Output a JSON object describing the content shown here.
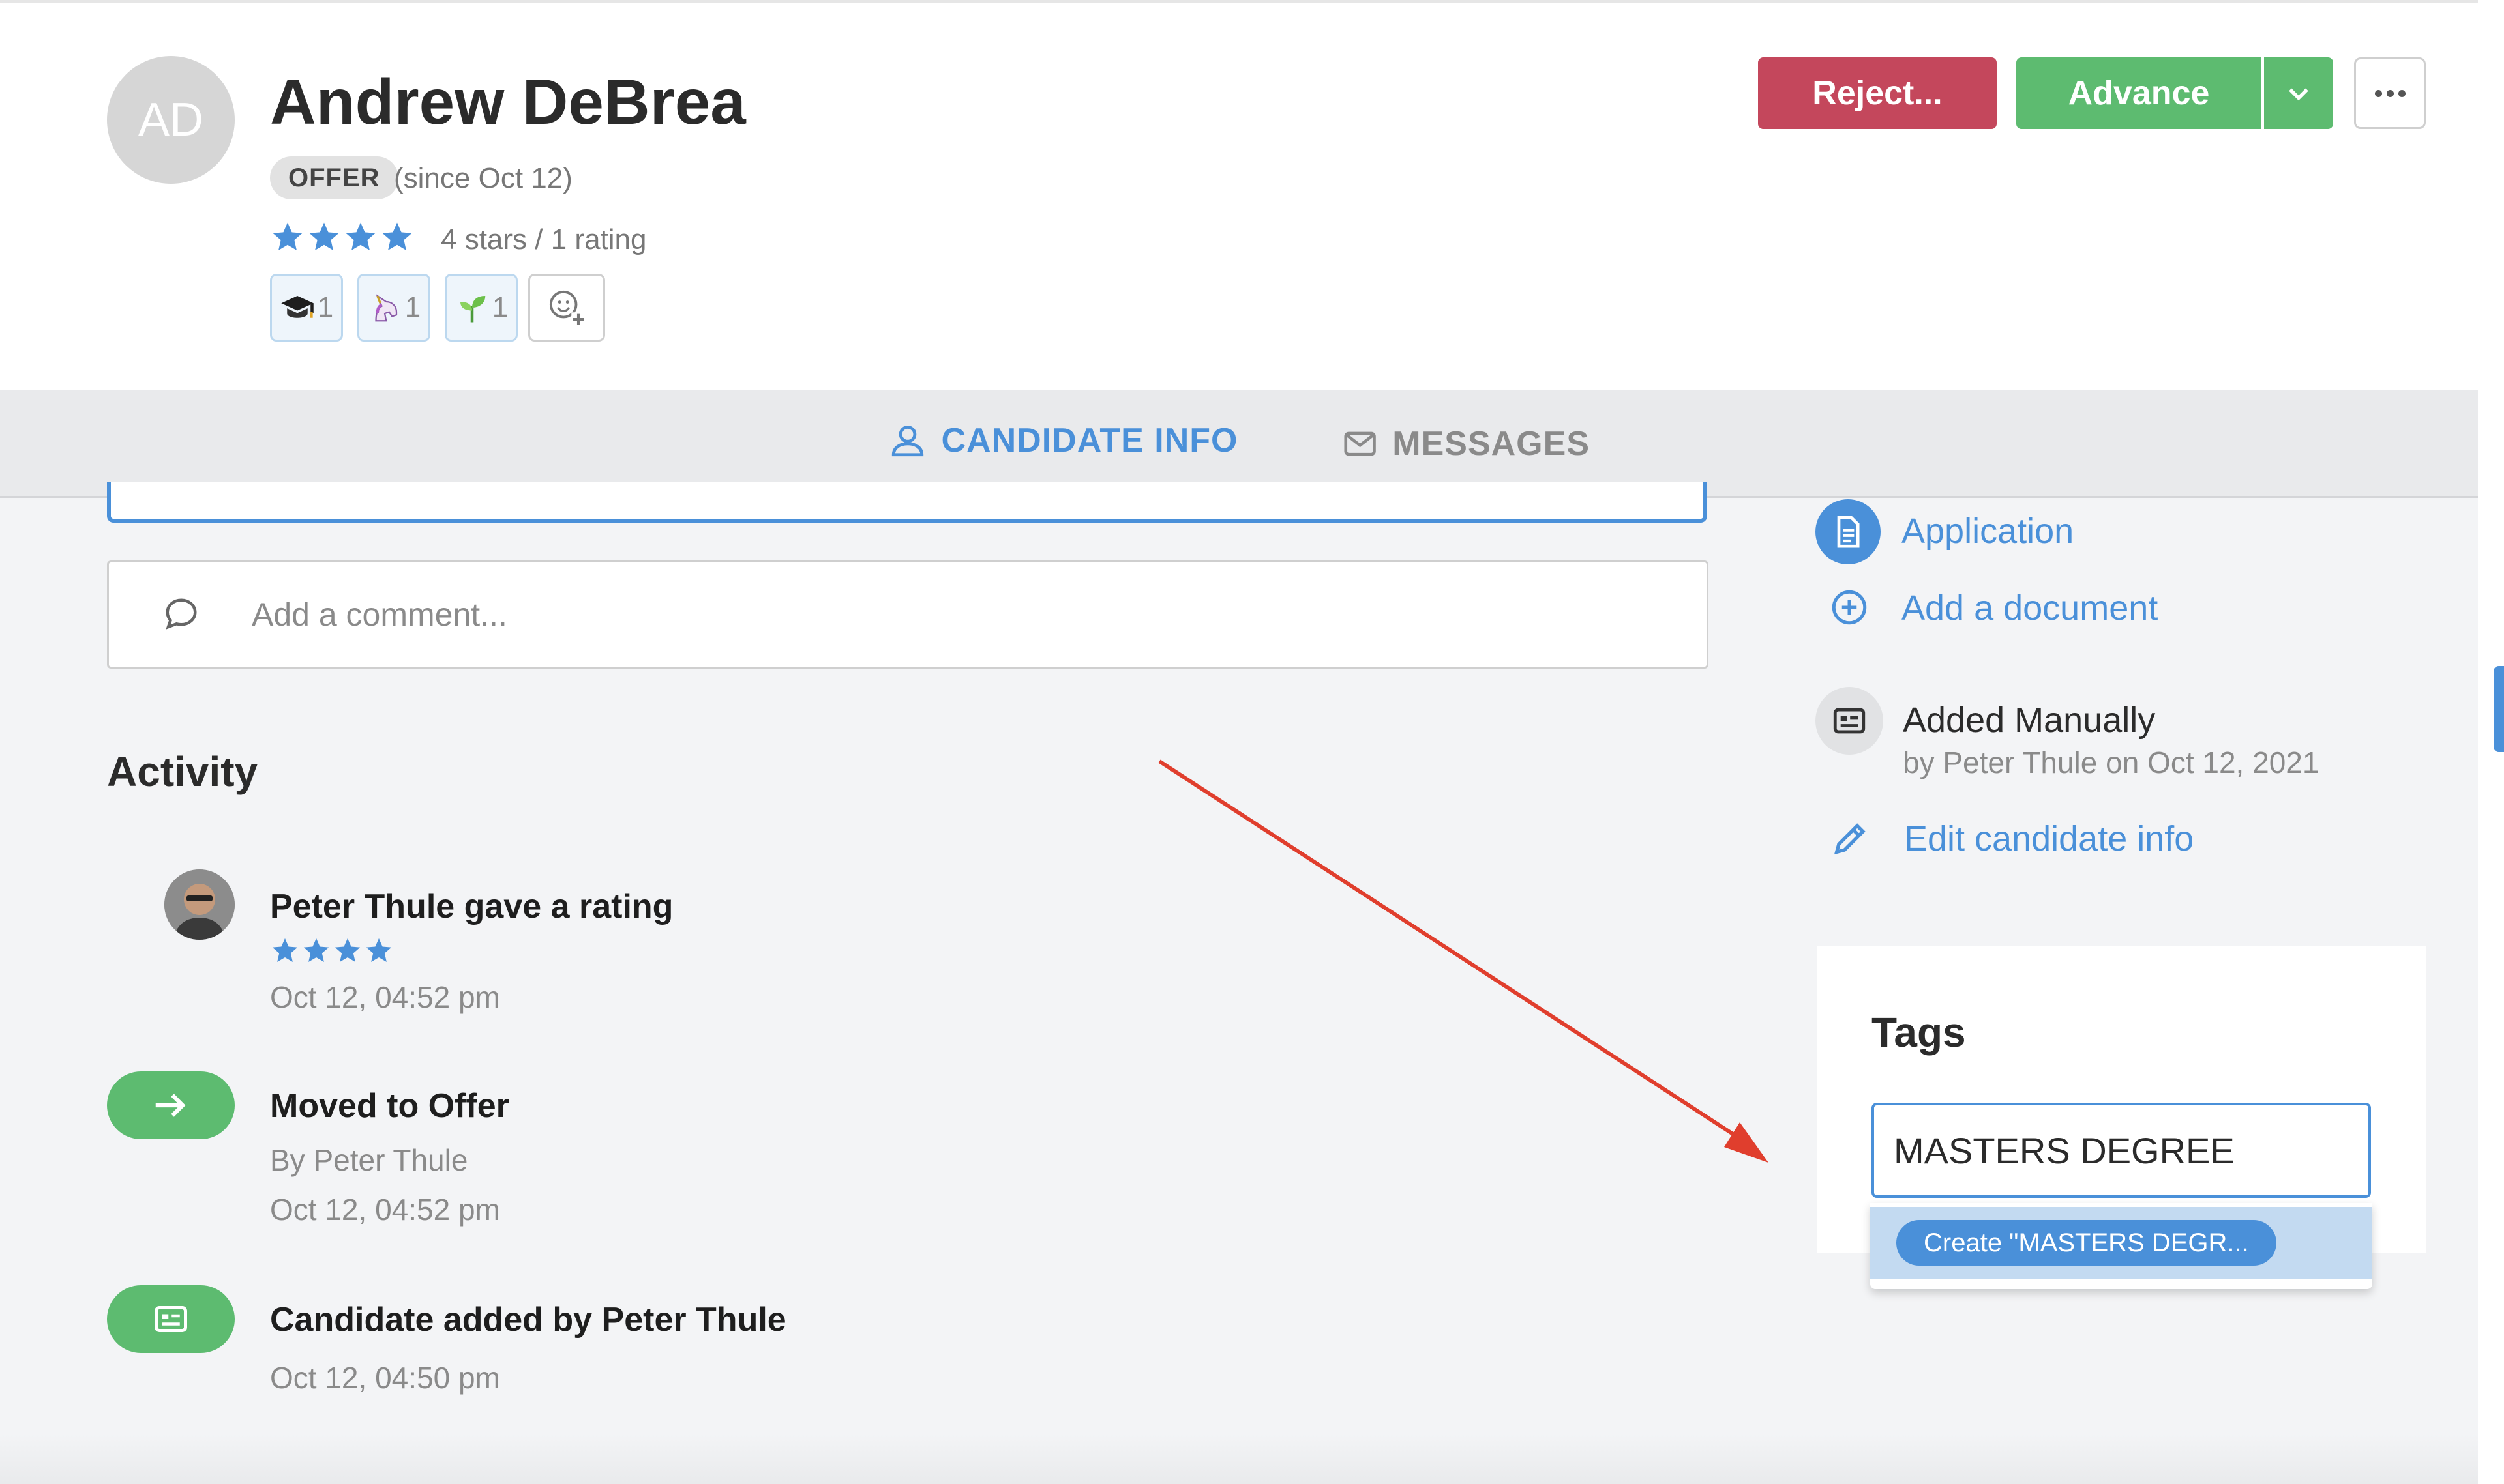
{
  "candidate": {
    "initials": "AD",
    "name": "Andrew DeBrea",
    "stage": "OFFER",
    "stage_since": "(since Oct 12)",
    "rating_text": "4 stars / 1 rating",
    "rating": 4,
    "reactions": [
      {
        "icon": "graduation-cap-icon",
        "count": "1"
      },
      {
        "icon": "unicorn-icon",
        "count": "1"
      },
      {
        "icon": "seedling-icon",
        "count": "1"
      }
    ]
  },
  "actions": {
    "reject_label": "Reject...",
    "advance_label": "Advance"
  },
  "tabs": [
    {
      "label": "CANDIDATE INFO",
      "icon": "user-icon",
      "active": true
    },
    {
      "label": "MESSAGES",
      "icon": "envelope-icon",
      "active": false
    }
  ],
  "comment": {
    "placeholder": "Add a comment..."
  },
  "activity": {
    "title": "Activity",
    "items": [
      {
        "title": "Peter Thule gave a rating",
        "rating": 4,
        "time": "Oct 12, 04:52 pm"
      },
      {
        "title": "Moved to Offer",
        "by": "By Peter Thule",
        "time": "Oct 12, 04:52 pm"
      },
      {
        "title": "Candidate added by Peter Thule",
        "time": "Oct 12, 04:50 pm"
      }
    ]
  },
  "sidebar": {
    "application_label": "Application",
    "add_document_label": "Add a document",
    "source_title": "Added Manually",
    "source_meta": "by Peter Thule on Oct 12, 2021",
    "edit_label": "Edit candidate info"
  },
  "tags": {
    "title": "Tags",
    "input_value": "MASTERS DEGREE",
    "create_option": "Create \"MASTERS DEGR..."
  },
  "colors": {
    "accent": "#4a90d9",
    "reject": "#c4475c",
    "advance": "#5dbb70",
    "annotation_arrow": "#e03e2d"
  }
}
